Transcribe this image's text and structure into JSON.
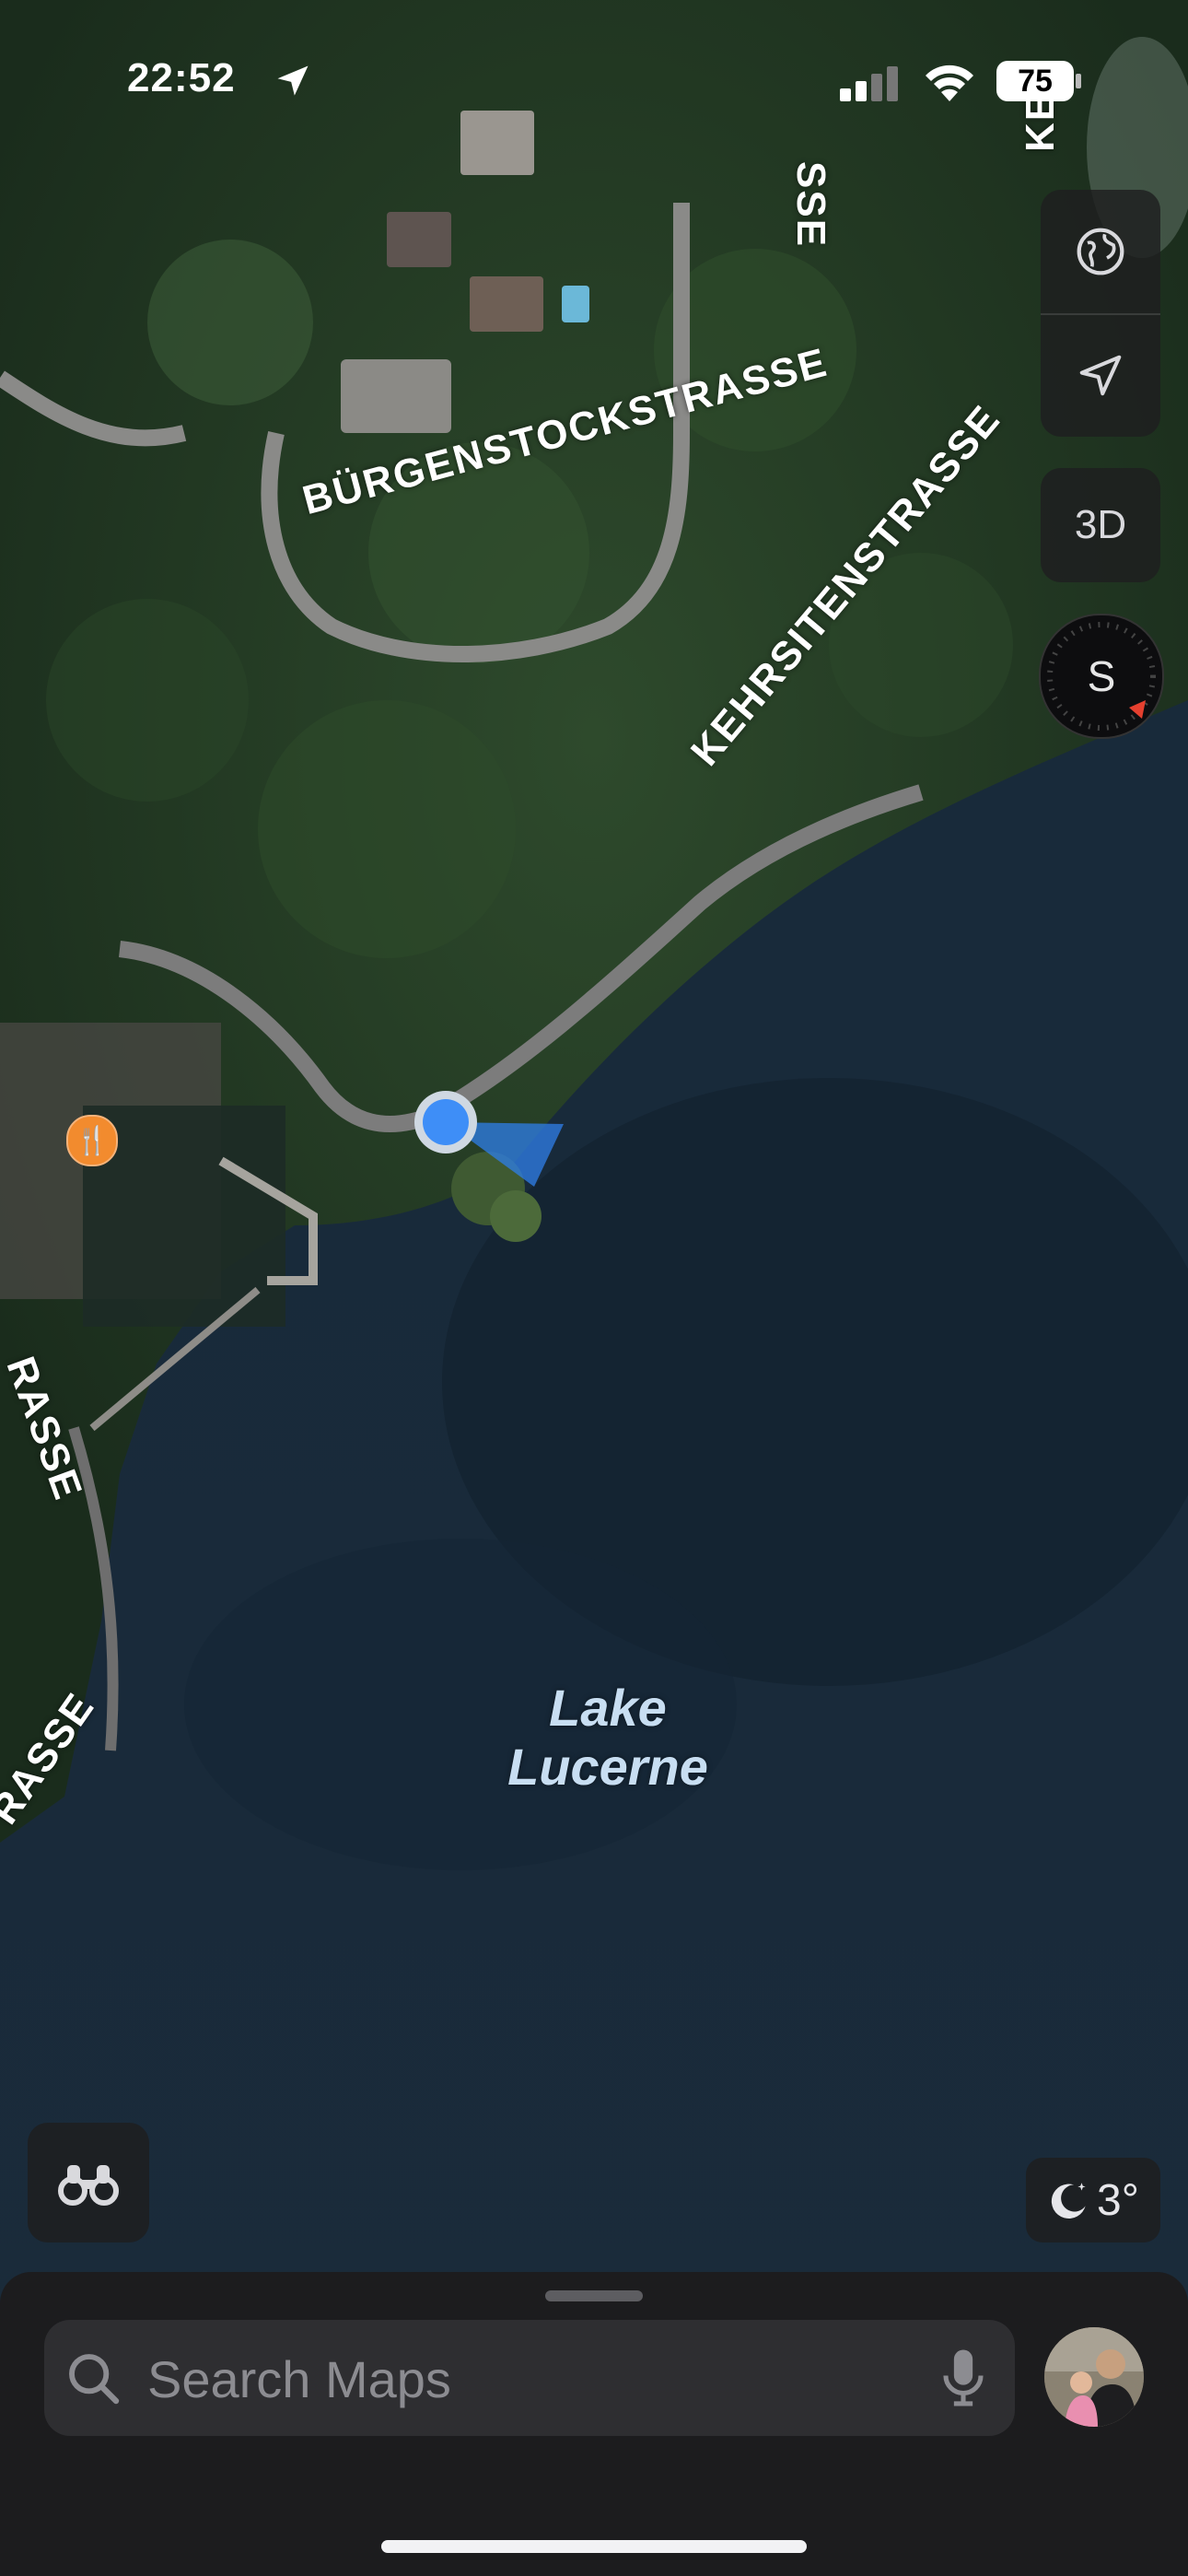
{
  "status_bar": {
    "time": "22:52",
    "battery_level": "75",
    "icons": [
      "location-arrow-icon",
      "cellular-signal-icon",
      "wifi-icon",
      "battery-icon"
    ]
  },
  "map": {
    "roads": [
      {
        "name": "BÜRGENSTOCKSTRASSE"
      },
      {
        "name": "KEHRSITENSTRASSE"
      },
      {
        "name": "SSE"
      },
      {
        "name": "KE"
      },
      {
        "name": "RASSE"
      },
      {
        "name": "RASSE"
      }
    ],
    "water_label": "Lake\nLucerne",
    "water_label_lines": [
      "Lake",
      "Lucerne"
    ],
    "poi": {
      "icon": "fork-knife-icon",
      "color": "#f28b2e"
    },
    "user_location": {
      "color": "#3e8ef7",
      "heading_cone_color": "#2f7fe9"
    }
  },
  "controls": {
    "globe_icon": "globe-icon",
    "location_icon": "location-arrow-outline-icon",
    "view_3d_label": "3D",
    "compass_label": "S",
    "look_around_icon": "binoculars-icon"
  },
  "weather": {
    "icon": "moon-stars-icon",
    "temperature": "3°"
  },
  "search": {
    "placeholder": "Search Maps",
    "value": "",
    "search_icon": "magnifying-glass-icon",
    "mic_icon": "microphone-icon",
    "avatar_icon": "profile-avatar"
  },
  "colors": {
    "accent_blue": "#3e8ef7",
    "sheet_bg": "#1c1c1e",
    "search_bg": "#2e2e31"
  }
}
